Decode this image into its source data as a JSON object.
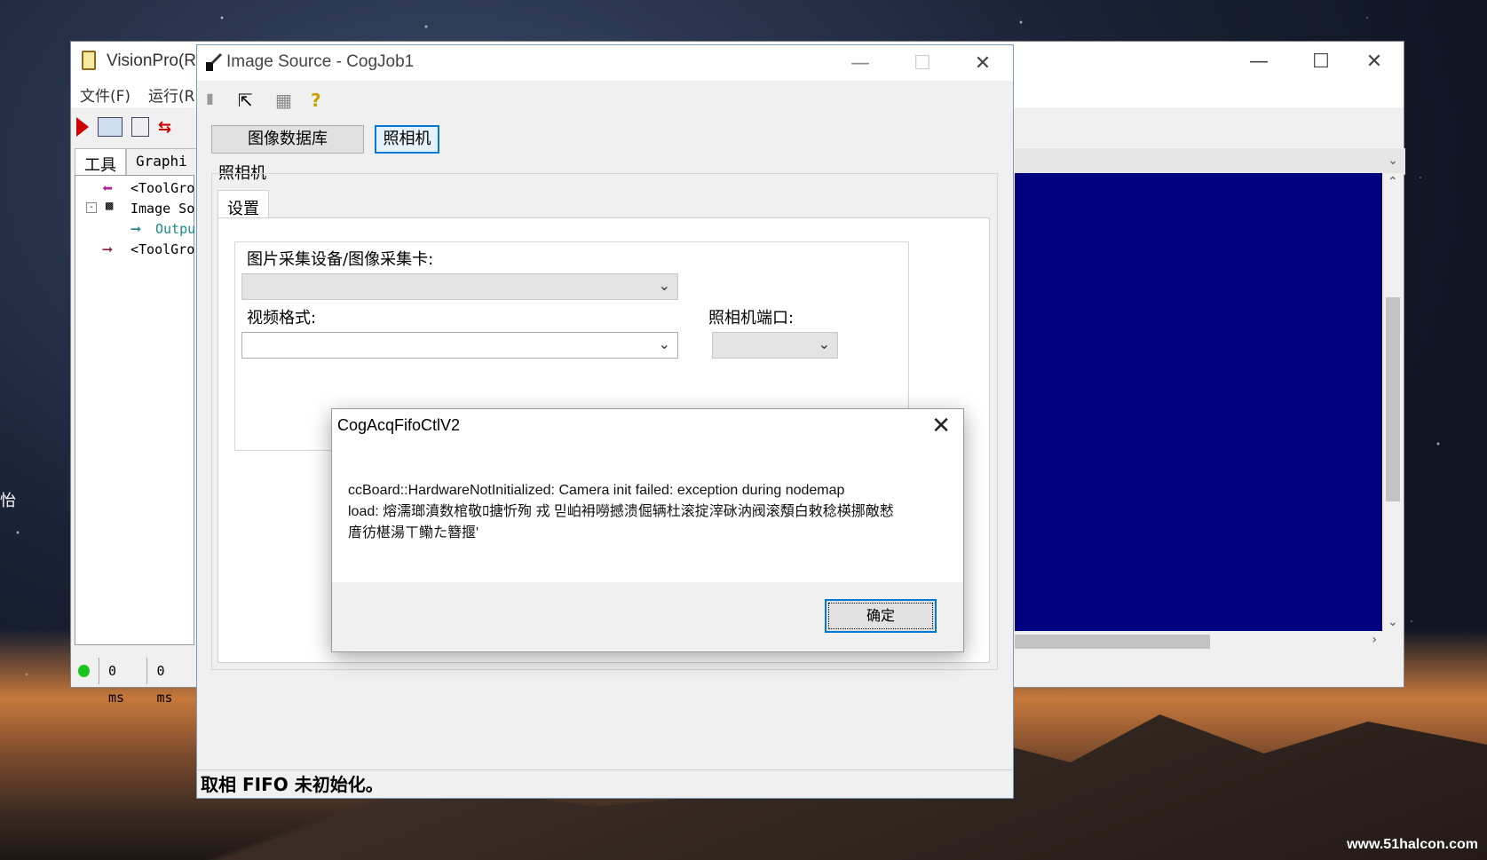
{
  "main_window": {
    "title": "VisionPro(R",
    "menu": [
      "文件(F)",
      "运行(R"
    ],
    "left_tabs": [
      "工具",
      "Graphi"
    ],
    "tree": [
      {
        "label": "<ToolGro"
      },
      {
        "label": "Image So"
      },
      {
        "label": "Outpu"
      },
      {
        "label": "<ToolGro"
      }
    ],
    "status": {
      "cell1": "0 ms",
      "cell2": "0 ms"
    },
    "display_color": "#000080"
  },
  "image_source": {
    "title": "Image Source - CogJob1",
    "source_buttons": {
      "database": "图像数据库",
      "camera": "照相机"
    },
    "group_label": "照相机",
    "tab_label": "设置",
    "device_label": "图片采集设备/图像采集卡:",
    "video_format_label": "视频格式:",
    "camera_port_label": "照相机端口:",
    "status_text": "取相 FIFO 未初始化。"
  },
  "dialog": {
    "title": "CogAcqFifoCtlV2",
    "message_line1": "ccBoard::HardwareNotInitialized: Camera init failed: exception during nodemap",
    "message_line2": "load: 熔濡瑯濆数棺敬ﾛ搪忻殉 戎 믿岶衻嘮撼溃倔辆杜滚掟滓砯汭阀滚頺白敕稔楧挪敵慭",
    "message_line3": "庴彷椹湯ㄒ鳓た簪揠'",
    "ok_label": "确定"
  },
  "desktop": {
    "watermark": "www.51halcon.com",
    "edge_char": "怡"
  }
}
